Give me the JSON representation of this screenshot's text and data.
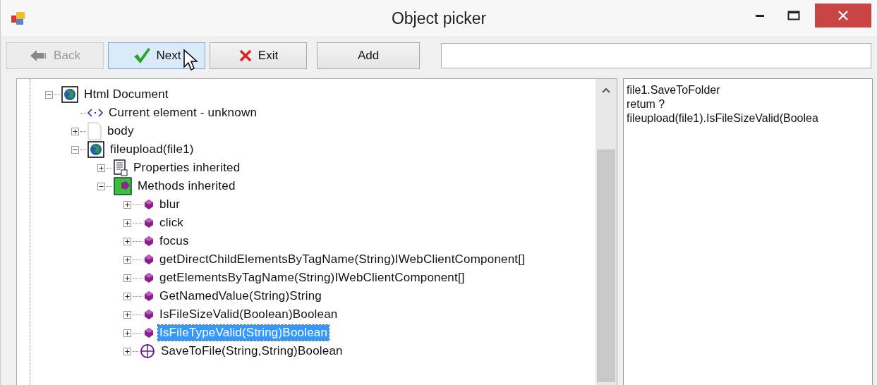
{
  "window": {
    "title": "Object picker"
  },
  "toolbar": {
    "buttons": [
      {
        "kind": "back",
        "label": "Back",
        "disabled": true,
        "hovered": false
      },
      {
        "kind": "next",
        "label": "Next",
        "disabled": false,
        "hovered": true
      },
      {
        "kind": "exit",
        "label": "Exit",
        "disabled": false,
        "hovered": false
      },
      {
        "kind": "plain",
        "label": "Add",
        "disabled": false,
        "hovered": false
      }
    ]
  },
  "tree": [
    {
      "kind": "globe",
      "label": "Html Document",
      "expanded": true,
      "selected": false,
      "children": [
        {
          "kind": "tag",
          "label": "Current element - unknown",
          "selected": false
        },
        {
          "kind": "page",
          "label": "body",
          "expanded": false,
          "selected": false
        },
        {
          "kind": "globe",
          "label": "fileupload(file1)",
          "expanded": true,
          "selected": false,
          "children": [
            {
              "kind": "properties",
              "label": "Properties inherited",
              "expanded": false,
              "selected": false
            },
            {
              "kind": "methods",
              "label": "Methods inherited",
              "expanded": true,
              "selected": false,
              "children": [
                {
                  "kind": "method",
                  "label": "blur",
                  "expanded": false,
                  "selected": false
                },
                {
                  "kind": "method",
                  "label": "click",
                  "expanded": false,
                  "selected": false
                },
                {
                  "kind": "method",
                  "label": "focus",
                  "expanded": false,
                  "selected": false
                },
                {
                  "kind": "method",
                  "label": "getDirectChildElementsByTagName(String)IWebClientComponent[]",
                  "expanded": false,
                  "selected": false
                },
                {
                  "kind": "method",
                  "label": "getElementsByTagName(String)IWebClientComponent[]",
                  "expanded": false,
                  "selected": false
                },
                {
                  "kind": "method",
                  "label": "GetNamedValue(String)String",
                  "expanded": false,
                  "selected": false
                },
                {
                  "kind": "method",
                  "label": "IsFileSizeValid(Boolean)Boolean",
                  "expanded": false,
                  "selected": false
                },
                {
                  "kind": "method",
                  "label": "IsFileTypeValid(String)Boolean",
                  "expanded": false,
                  "selected": true
                },
                {
                  "kind": "method-globe",
                  "label": "SaveToFile(String,String)Boolean",
                  "expanded": false,
                  "selected": false
                }
              ]
            }
          ]
        }
      ]
    }
  ],
  "output": {
    "lines": [
      "file1.SaveToFolder",
      "retum ?",
      "fileupload(file1).IsFileSizeValid(Boolea"
    ]
  }
}
